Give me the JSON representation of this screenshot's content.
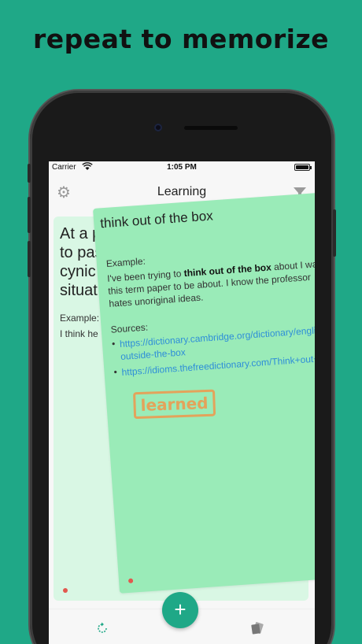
{
  "headline": "repeat to memorize",
  "status": {
    "carrier": "Carrier",
    "time": "1:05 PM",
    "battery_level": 1.0
  },
  "nav": {
    "title": "Learning"
  },
  "back_card": {
    "title": "At a p… to pas… cynic… situat…",
    "title_lines": [
      "At a p",
      "to pas",
      "cynic",
      "situat"
    ],
    "example_label": "Example:",
    "example_text": "I think he"
  },
  "front_card": {
    "term": "think out of the box",
    "example_label": "Example:",
    "example_before": "I've been trying to ",
    "example_bold": "think out of the box",
    "example_after": " about I want this term paper to be about. I know the professor hates unoriginal ideas.",
    "sources_label": "Sources:",
    "sources": [
      "https://dictionary.cambridge.org/dictionary/english/think-outside-the-box",
      "https://idioms.thefreedictionary.com/Think+out+of+the+box"
    ],
    "stamp": "learned"
  },
  "colors": {
    "brand": "#1fa887",
    "card_front": "#9aebb8",
    "card_back": "#d9f7e4",
    "stamp": "#e3a35b",
    "link": "#2e8ed8"
  },
  "icons": {
    "settings": "gear-icon",
    "filter": "filter-icon",
    "add": "plus-icon",
    "repeat": "repeat-icon",
    "cards": "cards-icon"
  },
  "fab_label": "+"
}
